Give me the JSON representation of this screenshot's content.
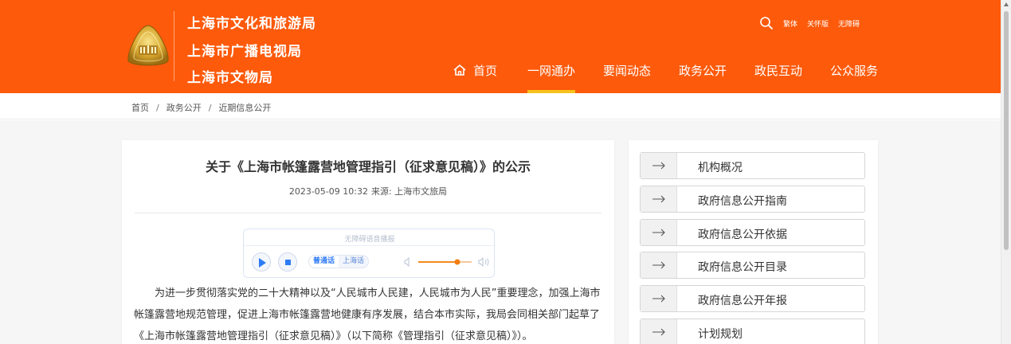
{
  "header": {
    "org_names": [
      "上海市文化和旅游局",
      "上海市广播电视局",
      "上海市文物局"
    ],
    "tools": [
      "繁体",
      "关怀版",
      "无障碍"
    ],
    "nav": [
      "首页",
      "一网通办",
      "要闻动态",
      "政务公开",
      "政民互动",
      "公众服务"
    ],
    "active_nav": "一网通办",
    "colors": {
      "bar": "#fd5a0b",
      "active_underline": "#f6c21b"
    }
  },
  "breadcrumb": {
    "items": [
      "首页",
      "政务公开",
      "近期信息公开"
    ],
    "separator": "/"
  },
  "article": {
    "title": "关于《上海市帐篷露营地管理指引（征求意见稿）》的公示",
    "datetime": "2023-05-09 10:32",
    "source": "来源:  上海市文旅局",
    "player": {
      "title": "无障碍语音播报",
      "lang_active": "普通话",
      "lang_other": "上海话"
    },
    "paragraph": "为进一步贯彻落实党的二十大精神以及“人民城市人民建，人民城市为人民”重要理念，加强上海市帐篷露营地规范管理，促进上海市帐篷露营地健康有序发展，结合本市实际，我局会同相关部门起草了《上海市帐篷露营地管理指引（征求意见稿）》（以下简称《管理指引（征求意见稿）》）。"
  },
  "sidebar": {
    "items": [
      "机构概况",
      "政府信息公开指南",
      "政府信息公开依据",
      "政府信息公开目录",
      "政府信息公开年报",
      "计划规划"
    ]
  }
}
